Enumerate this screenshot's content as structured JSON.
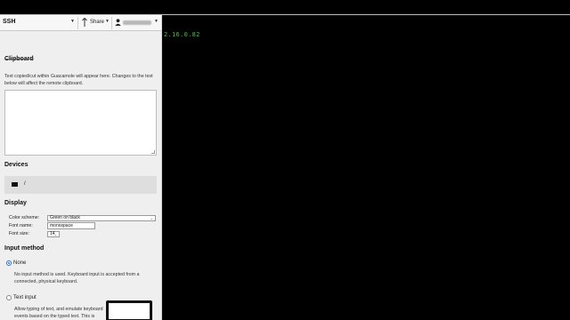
{
  "menu": {
    "title": "SSH",
    "share_label": "Share",
    "username": ""
  },
  "terminal": {
    "line": "2.16.0.82",
    "text_color": "#3ec04a"
  },
  "clipboard": {
    "heading": "Clipboard",
    "description": "Text copied/cut within Guacamole will appear here. Changes to the text below will affect the remote clipboard.",
    "value": ""
  },
  "devices": {
    "heading": "Devices",
    "drive_icon": "drive-icon",
    "path": "/"
  },
  "display": {
    "heading": "Display",
    "color_scheme_label": "Color scheme:",
    "color_scheme_value": "Green on black",
    "font_name_label": "Font name:",
    "font_name_value": "monospace",
    "font_size_label": "Font size:",
    "font_size_value": "14"
  },
  "input_method": {
    "heading": "Input method",
    "none_label": "None",
    "none_selected": true,
    "none_description": "No input method is used. Keyboard input is accepted from a connected, physical keyboard.",
    "text_input_label": "Text input",
    "text_input_selected": false,
    "text_input_description": "Allow typing of text, and emulate keyboard events based on the typed text. This is"
  }
}
